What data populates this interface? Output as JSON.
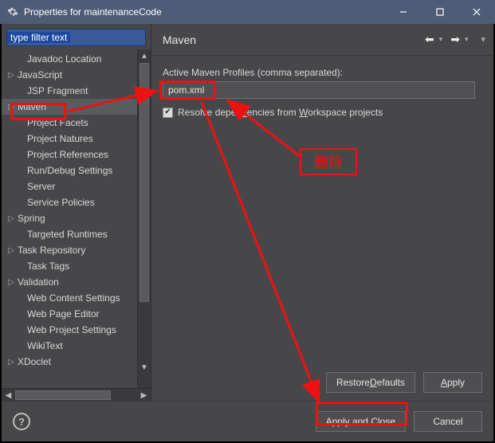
{
  "window": {
    "title": "Properties for maintenanceCode"
  },
  "sidebar": {
    "filter_placeholder": "type filter text",
    "items": [
      {
        "label": "Javadoc Location",
        "expandable": false,
        "indent": true
      },
      {
        "label": "JavaScript",
        "expandable": true,
        "indent": false
      },
      {
        "label": "JSP Fragment",
        "expandable": false,
        "indent": true
      },
      {
        "label": "Maven",
        "expandable": true,
        "indent": false,
        "selected": true
      },
      {
        "label": "Project Facets",
        "expandable": false,
        "indent": true
      },
      {
        "label": "Project Natures",
        "expandable": false,
        "indent": true
      },
      {
        "label": "Project References",
        "expandable": false,
        "indent": true
      },
      {
        "label": "Run/Debug Settings",
        "expandable": false,
        "indent": true
      },
      {
        "label": "Server",
        "expandable": false,
        "indent": true
      },
      {
        "label": "Service Policies",
        "expandable": false,
        "indent": true
      },
      {
        "label": "Spring",
        "expandable": true,
        "indent": false
      },
      {
        "label": "Targeted Runtimes",
        "expandable": false,
        "indent": true
      },
      {
        "label": "Task Repository",
        "expandable": true,
        "indent": false
      },
      {
        "label": "Task Tags",
        "expandable": false,
        "indent": true
      },
      {
        "label": "Validation",
        "expandable": true,
        "indent": false
      },
      {
        "label": "Web Content Settings",
        "expandable": false,
        "indent": true
      },
      {
        "label": "Web Page Editor",
        "expandable": false,
        "indent": true
      },
      {
        "label": "Web Project Settings",
        "expandable": false,
        "indent": true
      },
      {
        "label": "WikiText",
        "expandable": false,
        "indent": true
      },
      {
        "label": "XDoclet",
        "expandable": true,
        "indent": false
      }
    ]
  },
  "content": {
    "heading": "Maven",
    "profiles_label": "Active Maven Profiles (comma separated):",
    "profiles_value": "pom.xml",
    "resolve_prefix": "Resolve depen",
    "resolve_underline_1": "d",
    "resolve_mid": "encies from ",
    "resolve_underline_2": "W",
    "resolve_suffix": "orkspace projects",
    "resolve_checked": true
  },
  "buttons": {
    "restore_pre": "Restore ",
    "restore_u": "D",
    "restore_post": "efaults",
    "apply_pre": "",
    "apply_u": "A",
    "apply_post": "pply",
    "apply_close": "Apply and Close",
    "cancel": "Cancel"
  },
  "annotation": {
    "delete_label": "删除"
  }
}
